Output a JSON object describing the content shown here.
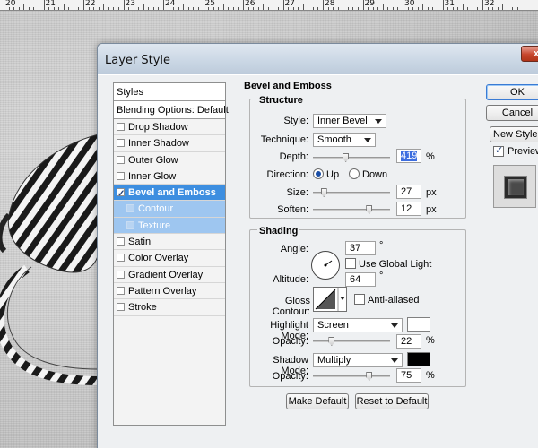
{
  "ruler": {
    "labels": [
      "20",
      "21",
      "22",
      "23",
      "24",
      "25",
      "26",
      "27",
      "28",
      "29",
      "30",
      "31",
      "32"
    ]
  },
  "dialog": {
    "title": "Layer Style",
    "close_glyph": "x"
  },
  "styles_list": {
    "header": "Styles",
    "blending": "Blending Options: Default",
    "items": [
      {
        "label": "Drop Shadow",
        "checked": false,
        "state": "normal"
      },
      {
        "label": "Inner Shadow",
        "checked": false,
        "state": "normal"
      },
      {
        "label": "Outer Glow",
        "checked": false,
        "state": "normal"
      },
      {
        "label": "Inner Glow",
        "checked": false,
        "state": "normal"
      },
      {
        "label": "Bevel and Emboss",
        "checked": true,
        "state": "active"
      },
      {
        "label": "Contour",
        "checked": false,
        "state": "sub"
      },
      {
        "label": "Texture",
        "checked": false,
        "state": "sub"
      },
      {
        "label": "Satin",
        "checked": false,
        "state": "normal"
      },
      {
        "label": "Color Overlay",
        "checked": false,
        "state": "normal"
      },
      {
        "label": "Gradient Overlay",
        "checked": false,
        "state": "normal"
      },
      {
        "label": "Pattern Overlay",
        "checked": false,
        "state": "normal"
      },
      {
        "label": "Stroke",
        "checked": false,
        "state": "normal"
      }
    ]
  },
  "bevel": {
    "section_title": "Bevel and Emboss",
    "structure": {
      "title": "Structure",
      "style_label": "Style:",
      "style_value": "Inner Bevel",
      "technique_label": "Technique:",
      "technique_value": "Smooth",
      "depth_label": "Depth:",
      "depth_value": "419",
      "depth_unit": "%",
      "depth_level": 0.42,
      "direction_label": "Direction:",
      "direction_up": "Up",
      "direction_down": "Down",
      "size_label": "Size:",
      "size_value": "27",
      "size_unit": "px",
      "size_level": 0.11,
      "soften_label": "Soften:",
      "soften_value": "12",
      "soften_unit": "px",
      "soften_level": 0.75
    },
    "shading": {
      "title": "Shading",
      "angle_label": "Angle:",
      "angle_value": "37",
      "angle_unit": "°",
      "global_light_label": "Use Global Light",
      "altitude_label": "Altitude:",
      "altitude_value": "64",
      "altitude_unit": "°",
      "gloss_label": "Gloss Contour:",
      "anti_aliased_label": "Anti-aliased",
      "highlight_mode_label": "Highlight Mode:",
      "highlight_mode_value": "Screen",
      "highlight_color": "#ffffff",
      "highlight_opacity_label": "Opacity:",
      "highlight_opacity_value": "22",
      "highlight_opacity_unit": "%",
      "highlight_opacity_level": 0.22,
      "shadow_mode_label": "Shadow Mode:",
      "shadow_mode_value": "Multiply",
      "shadow_color": "#000000",
      "shadow_opacity_label": "Opacity:",
      "shadow_opacity_value": "75",
      "shadow_opacity_unit": "%",
      "shadow_opacity_level": 0.75
    },
    "make_default": "Make Default",
    "reset_default": "Reset to Default"
  },
  "buttons": {
    "ok": "OK",
    "cancel": "Cancel",
    "new_style": "New Style...",
    "preview": "Preview"
  },
  "colors": {
    "accent": "#3d8ee0",
    "sub_highlight": "#9ec6f0"
  }
}
